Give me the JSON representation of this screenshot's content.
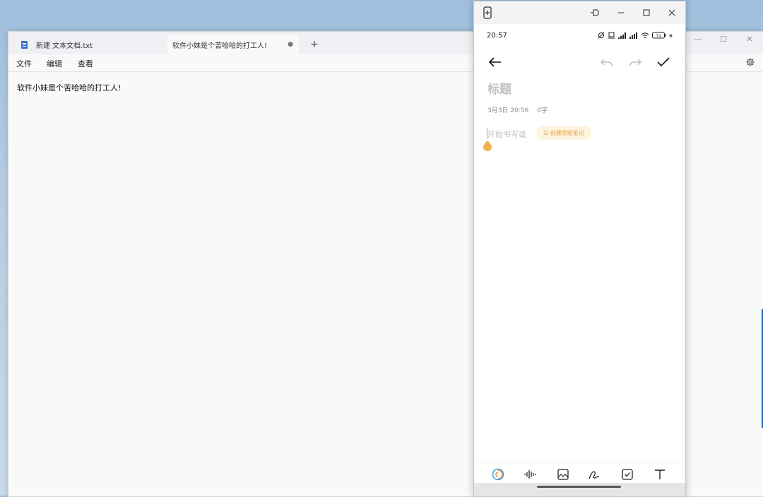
{
  "notepad": {
    "tabs": [
      {
        "label": "新建 文本文档.txt",
        "active": false
      },
      {
        "label": "软件小妹是个苦哈哈的打工人!",
        "active": true
      }
    ],
    "tab_close_glyph": "●",
    "new_tab_glyph": "+",
    "menu": [
      "文件",
      "编辑",
      "查看"
    ],
    "content": "软件小妹是个苦哈哈的打工人!",
    "window_controls": [
      "—",
      "☐",
      "✕"
    ]
  },
  "phone": {
    "status": {
      "time": "20:57",
      "battery": "74"
    },
    "note": {
      "title_placeholder": "标题",
      "date": "3月3日 20:56",
      "char_count": "0字",
      "body_placeholder": "开始书写或",
      "mindmap_button": "☰ 创建思维笔记"
    },
    "icons": {
      "titlebar": [
        "phone-screen-icon",
        "pin-icon",
        "minimize-icon",
        "maximize-icon",
        "close-icon"
      ],
      "appbar": [
        "back-arrow-icon",
        "undo-icon",
        "redo-icon",
        "checkmark-icon"
      ],
      "toolbar": [
        "ai-swirl-icon",
        "voice-wave-icon",
        "image-icon",
        "handwriting-icon",
        "checkbox-icon",
        "text-format-icon"
      ]
    },
    "accent_color": "#e8a93a"
  }
}
